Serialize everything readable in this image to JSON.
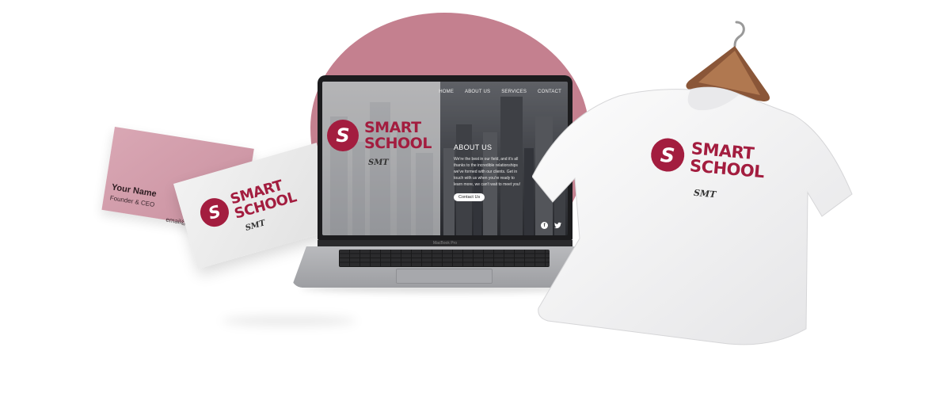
{
  "brand": {
    "logo_letter": "S",
    "word1": "SMART",
    "word2": "SCHOOL",
    "tagline": "SMT",
    "color": "#a31d3f"
  },
  "website": {
    "nav": [
      "HOME",
      "ABOUT US",
      "SERVICES",
      "CONTACT"
    ],
    "about_title": "ABOUT US",
    "about_text": "We're the best in our field, and it's all thanks to the incredible relationships we've formed with our clients. Get in touch with us when you're ready to learn more, we can't wait to meet you!",
    "cta_label": "Contact Us",
    "social_icons": [
      "facebook-icon",
      "twitter-icon"
    ]
  },
  "laptop": {
    "model_label": "MacBook Pro"
  },
  "business_card": {
    "name": "Your Name",
    "role": "Founder & CEO",
    "email": "email@"
  },
  "colors": {
    "blob": "#c4808f",
    "card_pink": "#d9a7b4"
  }
}
